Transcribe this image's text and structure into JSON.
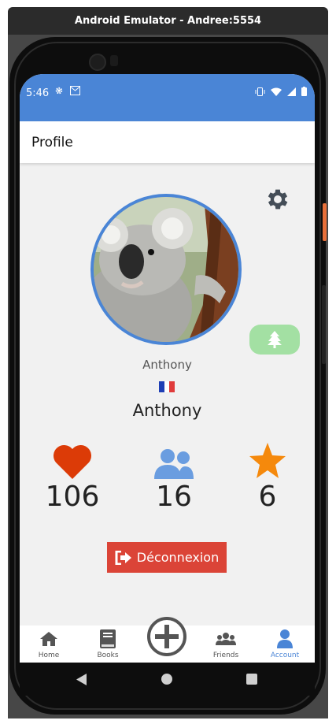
{
  "window": {
    "title": "Android Emulator - Andree:5554"
  },
  "status_bar": {
    "time": "5:46"
  },
  "app_bar": {
    "title": "Profile"
  },
  "profile": {
    "username_small": "Anthony",
    "username_big": "Anthony",
    "avatar_icon": "koala-photo",
    "flag_icon": "france-flag",
    "badge_icon": "tree-icon"
  },
  "stats": {
    "likes": {
      "icon": "heart-icon",
      "value": "106",
      "color": "#dc3b07"
    },
    "friends": {
      "icon": "users-icon",
      "value": "16",
      "color": "#6a9de0"
    },
    "favorites": {
      "icon": "star-icon",
      "value": "6",
      "color": "#f5890c"
    }
  },
  "logout": {
    "label": "Déconnexion",
    "icon": "sign-out-icon"
  },
  "bottom_nav": {
    "items": [
      {
        "label": "Home",
        "icon": "home-icon"
      },
      {
        "label": "Books",
        "icon": "book-icon"
      },
      {
        "label": "",
        "icon": "add-circle-icon"
      },
      {
        "label": "Friends",
        "icon": "users-icon"
      },
      {
        "label": "Account",
        "icon": "user-icon"
      }
    ],
    "active": "Account",
    "active_color": "#4a85d6"
  },
  "colors": {
    "primary": "#4a85d6",
    "logout": "#db4437",
    "badge": "#a3e0a3"
  }
}
